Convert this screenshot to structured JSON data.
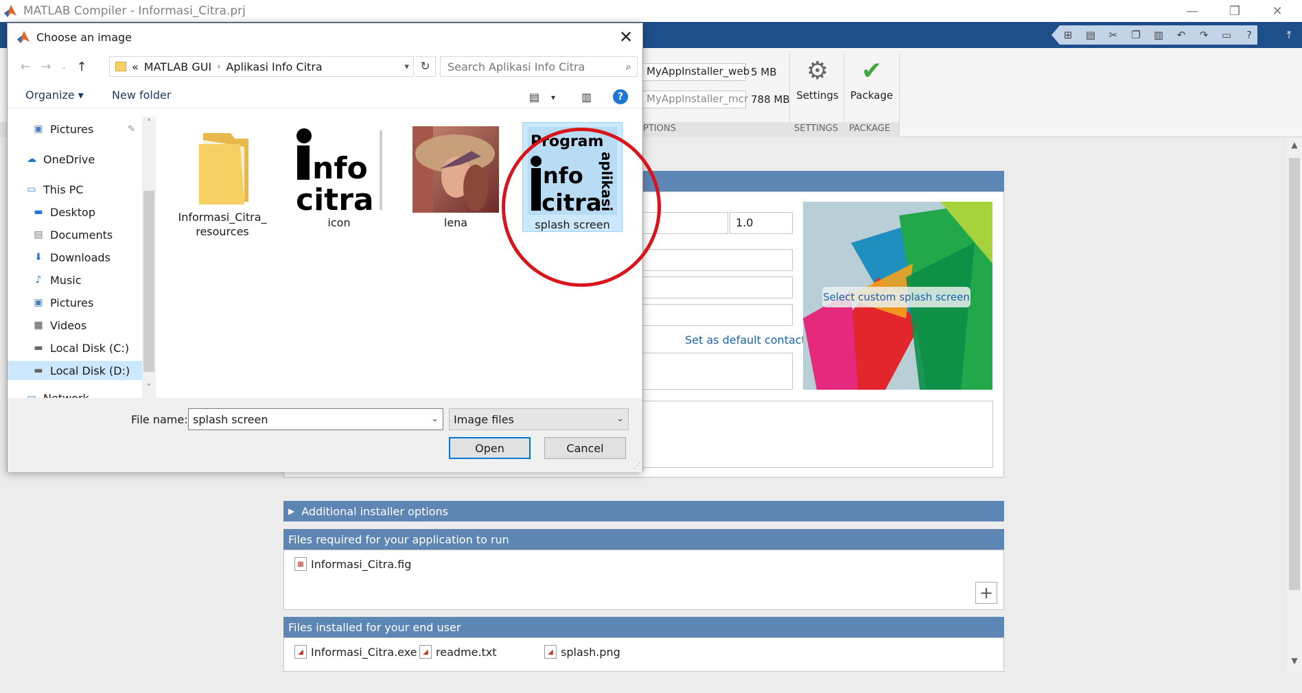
{
  "window": {
    "title": "MATLAB Compiler - Informasi_Citra.prj",
    "logo_icon": "matlab-logo-icon",
    "minimize_label": "—",
    "restore_label": "❐",
    "close_label": "✕"
  },
  "quick_access": [
    "save-icon",
    "cut-icon",
    "copy-icon",
    "paste-icon",
    "undo-icon",
    "redo-icon",
    "window-icon",
    "help-icon"
  ],
  "ribbon": {
    "web_installer_name": "MyAppInstaller_web",
    "web_installer_size": "5 MB",
    "mcr_installer_name": "MyAppInstaller_mcr",
    "mcr_installer_size": "788 MB",
    "settings_label": "Settings",
    "package_label": "Package",
    "section_options": "PTIONS",
    "section_settings": "SETTINGS",
    "section_package": "PACKAGE"
  },
  "main": {
    "version_value": "1.0",
    "set_default_contact": "Set as default contact",
    "select_splash": "Select custom splash screen",
    "additional_options": "Additional installer options",
    "files_required_header": "Files required for your application to run",
    "files_required": [
      "Informasi_Citra.fig"
    ],
    "files_installed_header": "Files installed for your end user",
    "files_installed": [
      "Informasi_Citra.exe",
      "readme.txt",
      "splash.png"
    ],
    "add_label": "+"
  },
  "dialog": {
    "title": "Choose an image",
    "close_label": "✕",
    "breadcrumb": [
      "«",
      "MATLAB GUI",
      "Aplikasi Info Citra"
    ],
    "search_placeholder": "Search Aplikasi Info Citra",
    "organize_label": "Organize ▾",
    "new_folder_label": "New folder",
    "help_label": "?",
    "nav_items": [
      {
        "label": "Pictures",
        "icon": "pictures-icon"
      },
      {
        "label": "OneDrive",
        "icon": "onedrive-icon"
      },
      {
        "label": "This PC",
        "icon": "computer-icon"
      },
      {
        "label": "Desktop",
        "icon": "desktop-icon"
      },
      {
        "label": "Documents",
        "icon": "documents-icon"
      },
      {
        "label": "Downloads",
        "icon": "downloads-icon"
      },
      {
        "label": "Music",
        "icon": "music-icon"
      },
      {
        "label": "Pictures",
        "icon": "pictures-icon"
      },
      {
        "label": "Videos",
        "icon": "videos-icon"
      },
      {
        "label": "Local Disk (C:)",
        "icon": "drive-icon"
      },
      {
        "label": "Local Disk (D:)",
        "icon": "drive-icon"
      },
      {
        "label": "Network",
        "icon": "network-icon"
      }
    ],
    "files": [
      {
        "label": "Informasi_Citra_resources",
        "type": "folder"
      },
      {
        "label": "icon",
        "type": "image"
      },
      {
        "label": "lena",
        "type": "image"
      },
      {
        "label": "splash screen",
        "type": "image",
        "selected": true
      }
    ],
    "icon_art": {
      "i": "i",
      "nfo": "nfo",
      "citra": "citra"
    },
    "splash_art": {
      "program": "Program",
      "aplikasi": "aplikasi",
      "i": "i",
      "nfo": "nfo",
      "citra": "citra"
    },
    "file_name_label": "File name:",
    "file_name_value": "splash screen",
    "file_type_value": "Image files",
    "open_label": "Open",
    "cancel_label": "Cancel"
  },
  "colors": {
    "toolstrip": "#1f4f8b",
    "panel_header": "#5d86b5",
    "selection": "#cce8ff",
    "highlight_circle": "#d9141b",
    "link": "#1d5fa9"
  }
}
